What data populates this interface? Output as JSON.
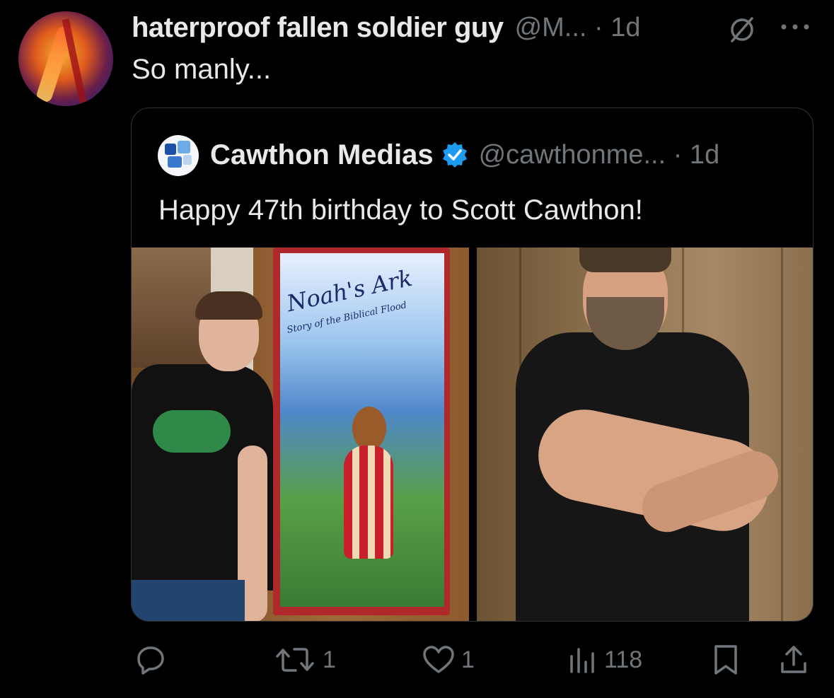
{
  "tweet": {
    "display_name": "haterproof fallen soldier guy",
    "handle_time": "@M... · 1d",
    "text": "So manly..."
  },
  "quote": {
    "display_name": "Cawthon Medias",
    "handle_time": "@cawthonme... · 1d",
    "text": "Happy 47th birthday to Scott Cawthon!",
    "photo_left_poster_title": "Noah's Ark",
    "photo_left_poster_subtitle": "Story of the Biblical Flood"
  },
  "actions": {
    "reply_count": "",
    "retweet_count": "1",
    "like_count": "1",
    "views_count": "118"
  },
  "colors": {
    "background": "#000000",
    "text_primary": "#e7e9ea",
    "text_secondary": "#71767b",
    "border": "#2f3336",
    "verified": "#1d9bf0"
  },
  "icons": [
    "muted-icon",
    "more-icon",
    "verified-badge-icon",
    "reply-icon",
    "retweet-icon",
    "like-icon",
    "views-icon",
    "bookmark-icon",
    "share-icon"
  ]
}
